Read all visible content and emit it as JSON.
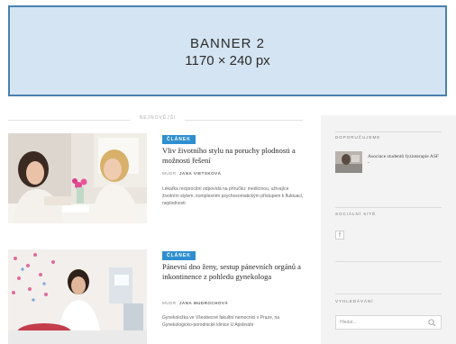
{
  "banner": {
    "line1": "BANNER 2",
    "line2": "1170 × 240 px"
  },
  "section": {
    "label": "NEJNOVĚJŠÍ"
  },
  "articles": [
    {
      "badge": "ČLÁNEK",
      "title": "Vliv životního stylu na poruchy plodnosti a možnosti řešení",
      "author_prefix": "MUDR.",
      "author": "JANA VIETSKOVÁ",
      "excerpt": "Lékařka reciprocitní odpovídá na příručku: medicínou, užívajíce životním stylem, komplexním psychosomatickým přístupem k fluktuaci, neplodnosti"
    },
    {
      "badge": "ČLÁNEK",
      "title": "Pánevní dno ženy, sestup pánevních orgánů a inkontinence z pohledu gynekologa",
      "author_prefix": "MUDR.",
      "author": "JANA MUDROCHOVÁ",
      "excerpt": "Gynekoložka ve Všeobecné fakultní nemocnici v Praze, na Gynekologicko-porodnické klinice U Apolináře"
    }
  ],
  "sidebar": {
    "recommended_title": "DOPORUČUJEME",
    "recommended_item": "Asociace studentů fyzioterapie ASF -",
    "social_title": "SOCIÁLNÍ SÍTĚ",
    "facebook_icon": "facebook-icon",
    "search_title": "VYHLEDÁVÁNÍ",
    "search_placeholder": "Hledat..."
  },
  "colors": {
    "banner_bg": "#d4e4f2",
    "banner_border": "#4a80b0",
    "badge": "#2f8fd0",
    "sidebar_bg": "#f3f3f3"
  }
}
